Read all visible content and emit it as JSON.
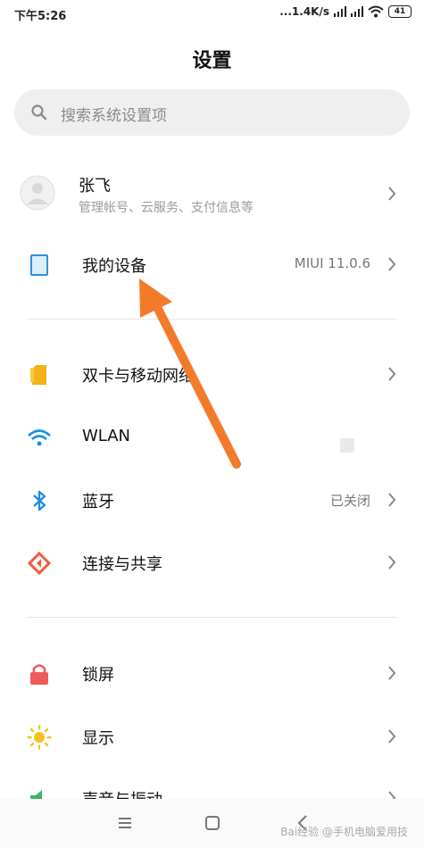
{
  "status": {
    "time": "下午5:26",
    "speed": "...1.4K/s",
    "battery": "41"
  },
  "title": "设置",
  "search": {
    "placeholder": "搜索系统设置项"
  },
  "account": {
    "name": "张飞",
    "subtitle": "管理帐号、云服务、支付信息等"
  },
  "device": {
    "label": "我的设备",
    "value": "MIUI 11.0.6"
  },
  "items": [
    {
      "label": "双卡与移动网络",
      "value": ""
    },
    {
      "label": "WLAN",
      "value": ""
    },
    {
      "label": "蓝牙",
      "value": "已关闭"
    },
    {
      "label": "连接与共享",
      "value": ""
    },
    {
      "label": "锁屏",
      "value": ""
    },
    {
      "label": "显示",
      "value": ""
    },
    {
      "label": "声音与振动",
      "value": ""
    }
  ],
  "watermark": "Bai经验 @手机电脑爱用技",
  "colors": {
    "accent_arrow": "#f47a2b",
    "sim_icon": "#f2b21c",
    "wlan_icon": "#1a8fe0",
    "bluetooth_icon": "#1a8fe0",
    "share_icon": "#f05a3e",
    "lock_icon": "#f05a5a",
    "display_icon": "#f5c21b",
    "sound_icon": "#3ab56b"
  }
}
